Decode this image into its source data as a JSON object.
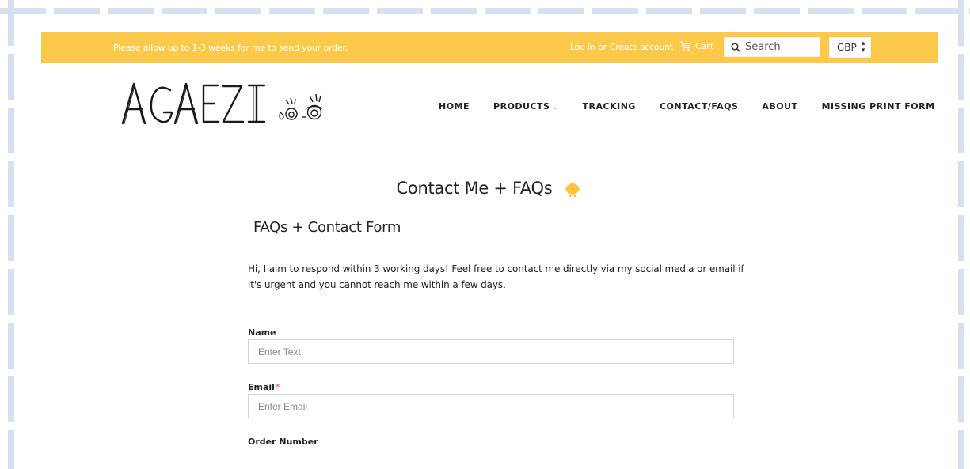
{
  "topbar": {
    "announcement": "Please allow up to 1-3 weeks for me to send your order.",
    "login": "Log in",
    "or": "or",
    "create_account": "Create account",
    "cart": "Cart",
    "search_placeholder": "Search",
    "currency": "GBP"
  },
  "header": {
    "logo_text": "AGAEZI",
    "nav": [
      {
        "label": "HOME"
      },
      {
        "label": "PRODUCTS"
      },
      {
        "label": "TRACKING"
      },
      {
        "label": "CONTACT/FAQS"
      },
      {
        "label": "ABOUT"
      },
      {
        "label": "MISSING PRINT FORM"
      }
    ]
  },
  "main": {
    "page_title": "Contact Me + FAQs",
    "form_title": "FAQs + Contact Form",
    "intro": "Hi, I aim to respond within 3 working days! Feel free to contact me directly via my social media or email if it's urgent and you cannot reach me within a few days.",
    "fields": {
      "name_label": "Name",
      "name_placeholder": "Enter Text",
      "email_label": "Email",
      "email_required": "*",
      "email_placeholder": "Enter Email",
      "order_label": "Order Number"
    }
  },
  "colors": {
    "topbar": "#fdc94b",
    "text": "#222222",
    "frame": "#d8dff0",
    "required": "#ee4444"
  },
  "icons": [
    "cart-icon",
    "search-icon",
    "select-caret-icon",
    "chick-icon",
    "chevron-down-icon"
  ]
}
